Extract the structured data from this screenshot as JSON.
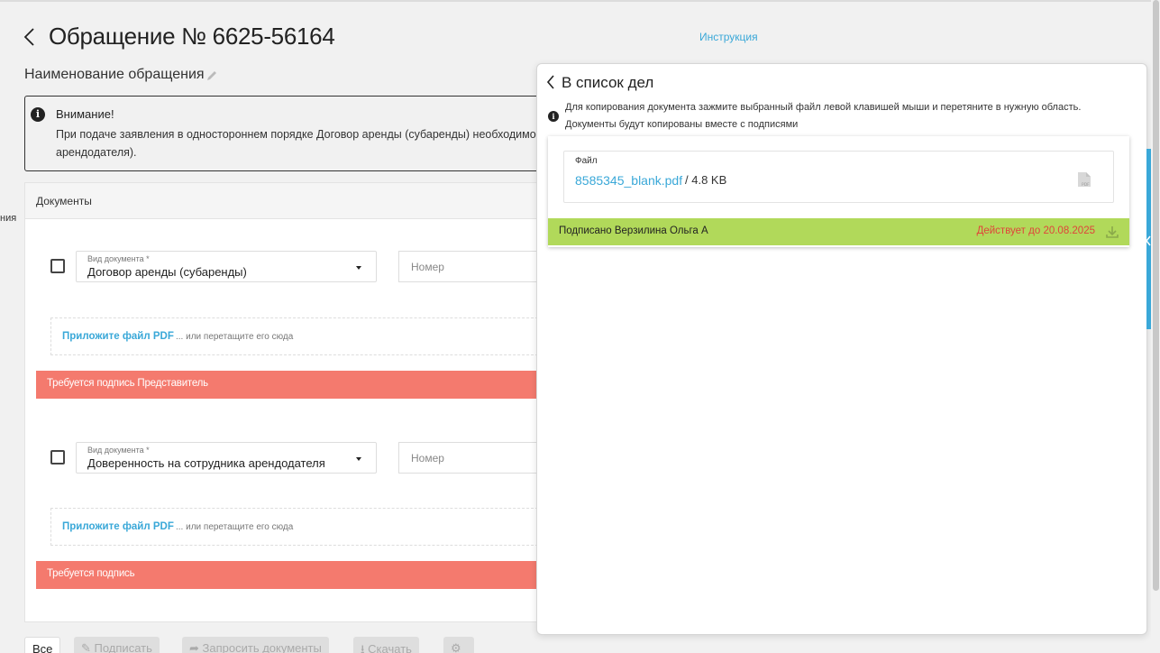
{
  "header": {
    "title": "Обращение № 6625-56164",
    "instruction_link": "Инструкция",
    "subject": "Наименование обращения"
  },
  "attention": {
    "title": "Внимание!",
    "text_line1": "При подаче заявления в одностороннем порядке Договор аренды (субаренды) необходимо подписыв",
    "text_line2": "арендодателя)."
  },
  "side_text": "ния",
  "documents": {
    "header": "Документы",
    "items": [
      {
        "type_label": "Вид документа *",
        "type_value": "Договор аренды (субаренды)",
        "number_placeholder": "Номер",
        "attach_label": "Приложите файл PDF",
        "drop_hint": "... или перетащите его сюда",
        "status": "Требуется подпись Представитель"
      },
      {
        "type_label": "Вид документа *",
        "type_value": "Доверенность на сотрудника арендодателя",
        "number_placeholder": "Номер",
        "attach_label": "Приложите файл PDF",
        "drop_hint": "... или перетащите его сюда",
        "status": "Требуется подпись"
      }
    ]
  },
  "bottom_bar": {
    "all": "Все",
    "sign": "Подписать",
    "request": "Запросить документы",
    "download": "Скачать"
  },
  "overlay": {
    "back_label": "В список дел",
    "hint": "Для копирования документа зажмите выбранный файл левой клавишей мыши и перетяните в нужную область. Документы будут копированы вместе с подписями",
    "file_label": "Файл",
    "file_name": "8585345_blank.pdf",
    "file_size": "/ 4.8 KB",
    "signed_by": "Подписано Верзилина Ольга А",
    "valid_until": "Действует до 20.08.2025"
  },
  "colors": {
    "accent": "#3aa8d8",
    "status_required": "#f47a6e",
    "signed": "#b1d95a",
    "valid_date": "#e0443a"
  }
}
